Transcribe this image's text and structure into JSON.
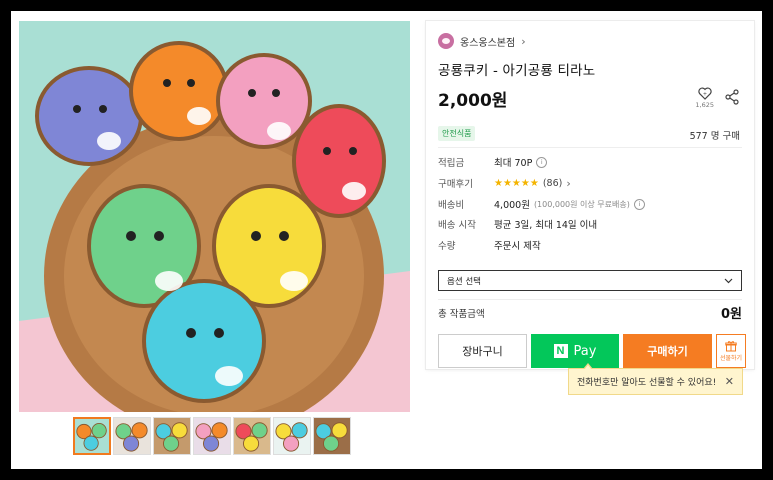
{
  "shop": {
    "name": "옹스옹스본점",
    "chevron": "›"
  },
  "product": {
    "title": "공룡쿠키 - 아기공룡 티라노",
    "price": "2,000원",
    "like_count": "1,625",
    "badge": "안전식품",
    "purchase_count": "577 명 구매"
  },
  "info": {
    "points_label": "적립금",
    "points_value": "최대 70P",
    "review_label": "구매후기",
    "review_stars": "★★★★★",
    "review_count": "(86)",
    "shipping_label": "배송비",
    "shipping_value": "4,000원",
    "shipping_sub": "(100,000원 이상 무료배송)",
    "start_label": "배송 시작",
    "start_value": "평균 3일, 최대 14일 이내",
    "qty_label": "수량",
    "qty_value": "주문시 제작"
  },
  "option": {
    "placeholder": "옵션 선택"
  },
  "total": {
    "label": "총 작품금액",
    "value": "0원"
  },
  "buttons": {
    "cart": "장바구니",
    "npay": "Pay",
    "npay_logo": "N",
    "buy": "구매하기",
    "gift": "선물하기"
  },
  "tooltip": {
    "text": "전화번호만 알아도 선물할 수 있어요!",
    "close": "✕"
  },
  "colors": {
    "accent": "#f57c22",
    "npay": "#03c75a",
    "badge_bg": "#e6f6ea",
    "stars": "#f4b400"
  },
  "icons": [
    "heart-icon",
    "share-icon",
    "info-icon",
    "chevron-down-icon",
    "gift-icon",
    "close-icon"
  ],
  "gallery": {
    "thumbnail_count": 7,
    "active_index": 0
  }
}
